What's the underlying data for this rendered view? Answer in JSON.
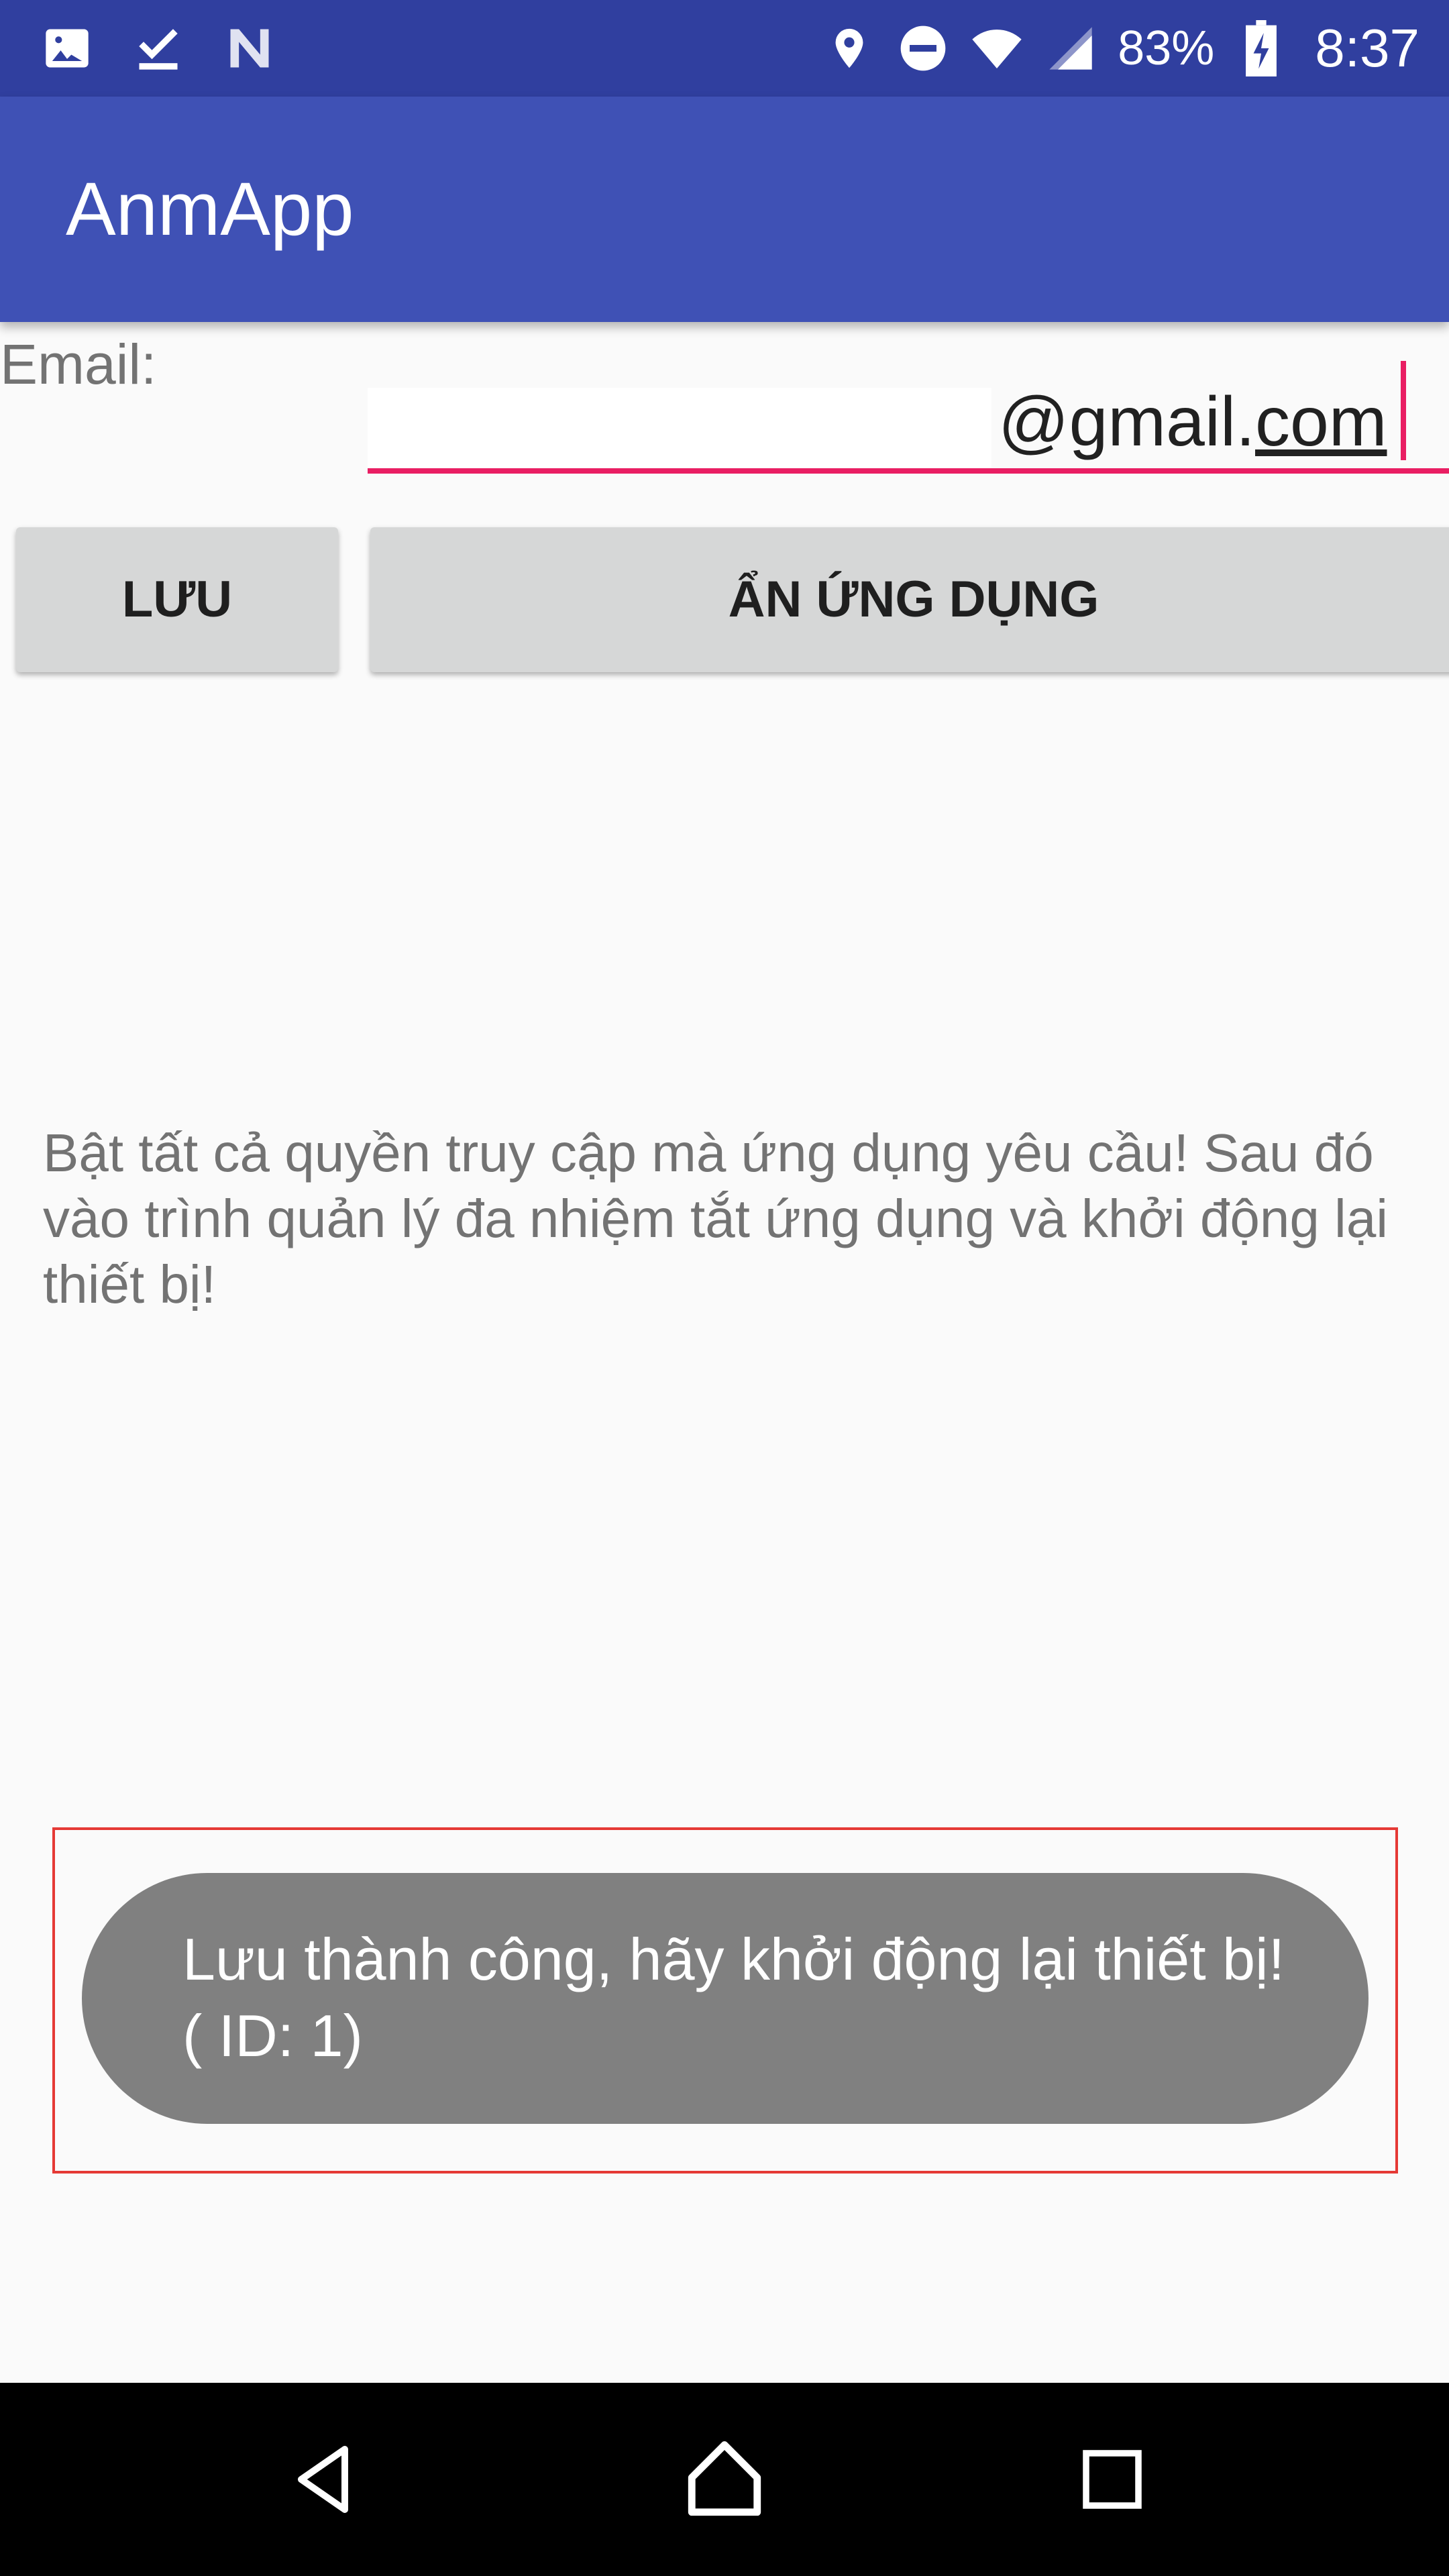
{
  "status_bar": {
    "battery": "83%",
    "time": "8:37",
    "icons_left": [
      "image-icon",
      "check-download-icon",
      "n-icon"
    ],
    "icons_right": [
      "location-icon",
      "dnd-icon",
      "wifi-icon",
      "signal-icon",
      "battery-icon"
    ]
  },
  "app_bar": {
    "title": "AnmApp",
    "color": "#3f51b5"
  },
  "form": {
    "email_label": "Email:",
    "email_value_visible": "@gmail.",
    "email_value_underlined": "com",
    "accent_color": "#e91e63"
  },
  "buttons": {
    "save": "LƯU",
    "hide_app": "ẨN ỨNG DỤNG"
  },
  "instructions": "Bật tất cả quyền truy cập mà ứng dụng yêu cầu! Sau đó vào trình quản lý đa nhiệm tắt ứng dụng và khởi động lại thiết bị!",
  "toast": {
    "line1": "Lưu thành công, hãy khởi động lại thiết bị!",
    "line2": "( ID: 1)"
  },
  "nav_bar": {
    "icons": [
      "back-icon",
      "home-icon",
      "recents-icon"
    ]
  }
}
